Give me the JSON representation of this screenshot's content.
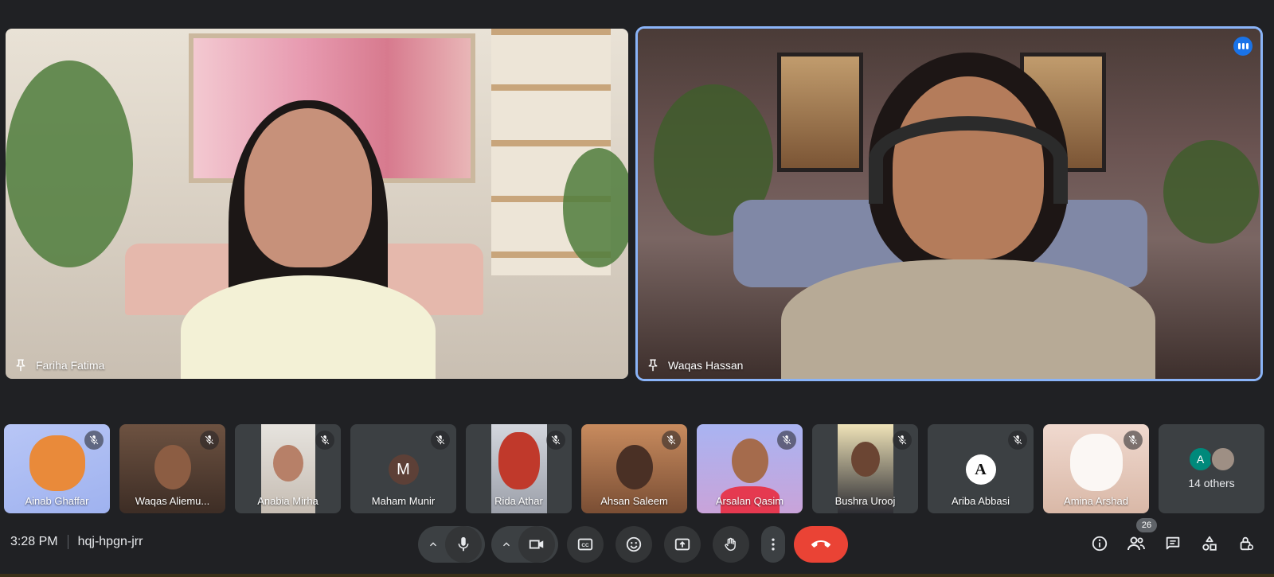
{
  "main_tiles": [
    {
      "name": "Fariha Fatima"
    },
    {
      "name": "Waqas Hassan"
    }
  ],
  "thumbnails": [
    {
      "name": "Ainab Ghaffar"
    },
    {
      "name": "Waqas Aliemu..."
    },
    {
      "name": "Anabia Mirha"
    },
    {
      "name": "Maham Munir",
      "initial": "M"
    },
    {
      "name": "Rida Athar"
    },
    {
      "name": "Ahsan Saleem"
    },
    {
      "name": "Arsalan Qasim"
    },
    {
      "name": "Bushra Urooj"
    },
    {
      "name": "Ariba Abbasi",
      "initial": "A"
    },
    {
      "name": "Amina Arshad"
    }
  ],
  "others": {
    "label": "14 others",
    "avatar_initial": "A"
  },
  "footer": {
    "time": "3:28 PM",
    "meeting_code": "hqj-hpgn-jrr",
    "people_count": "26"
  },
  "colors": {
    "accent_blue": "#8ab4f8",
    "end_call_red": "#ea4335",
    "background": "#202124",
    "tile_bg": "#3c4043"
  },
  "icons": [
    "pin-icon",
    "more-options-icon",
    "mic-off-icon",
    "chevron-up-icon",
    "mic-icon",
    "camera-icon",
    "captions-icon",
    "emoji-icon",
    "present-screen-icon",
    "raise-hand-icon",
    "more-vert-icon",
    "end-call-icon",
    "info-icon",
    "people-icon",
    "chat-icon",
    "activities-icon",
    "host-controls-icon"
  ]
}
